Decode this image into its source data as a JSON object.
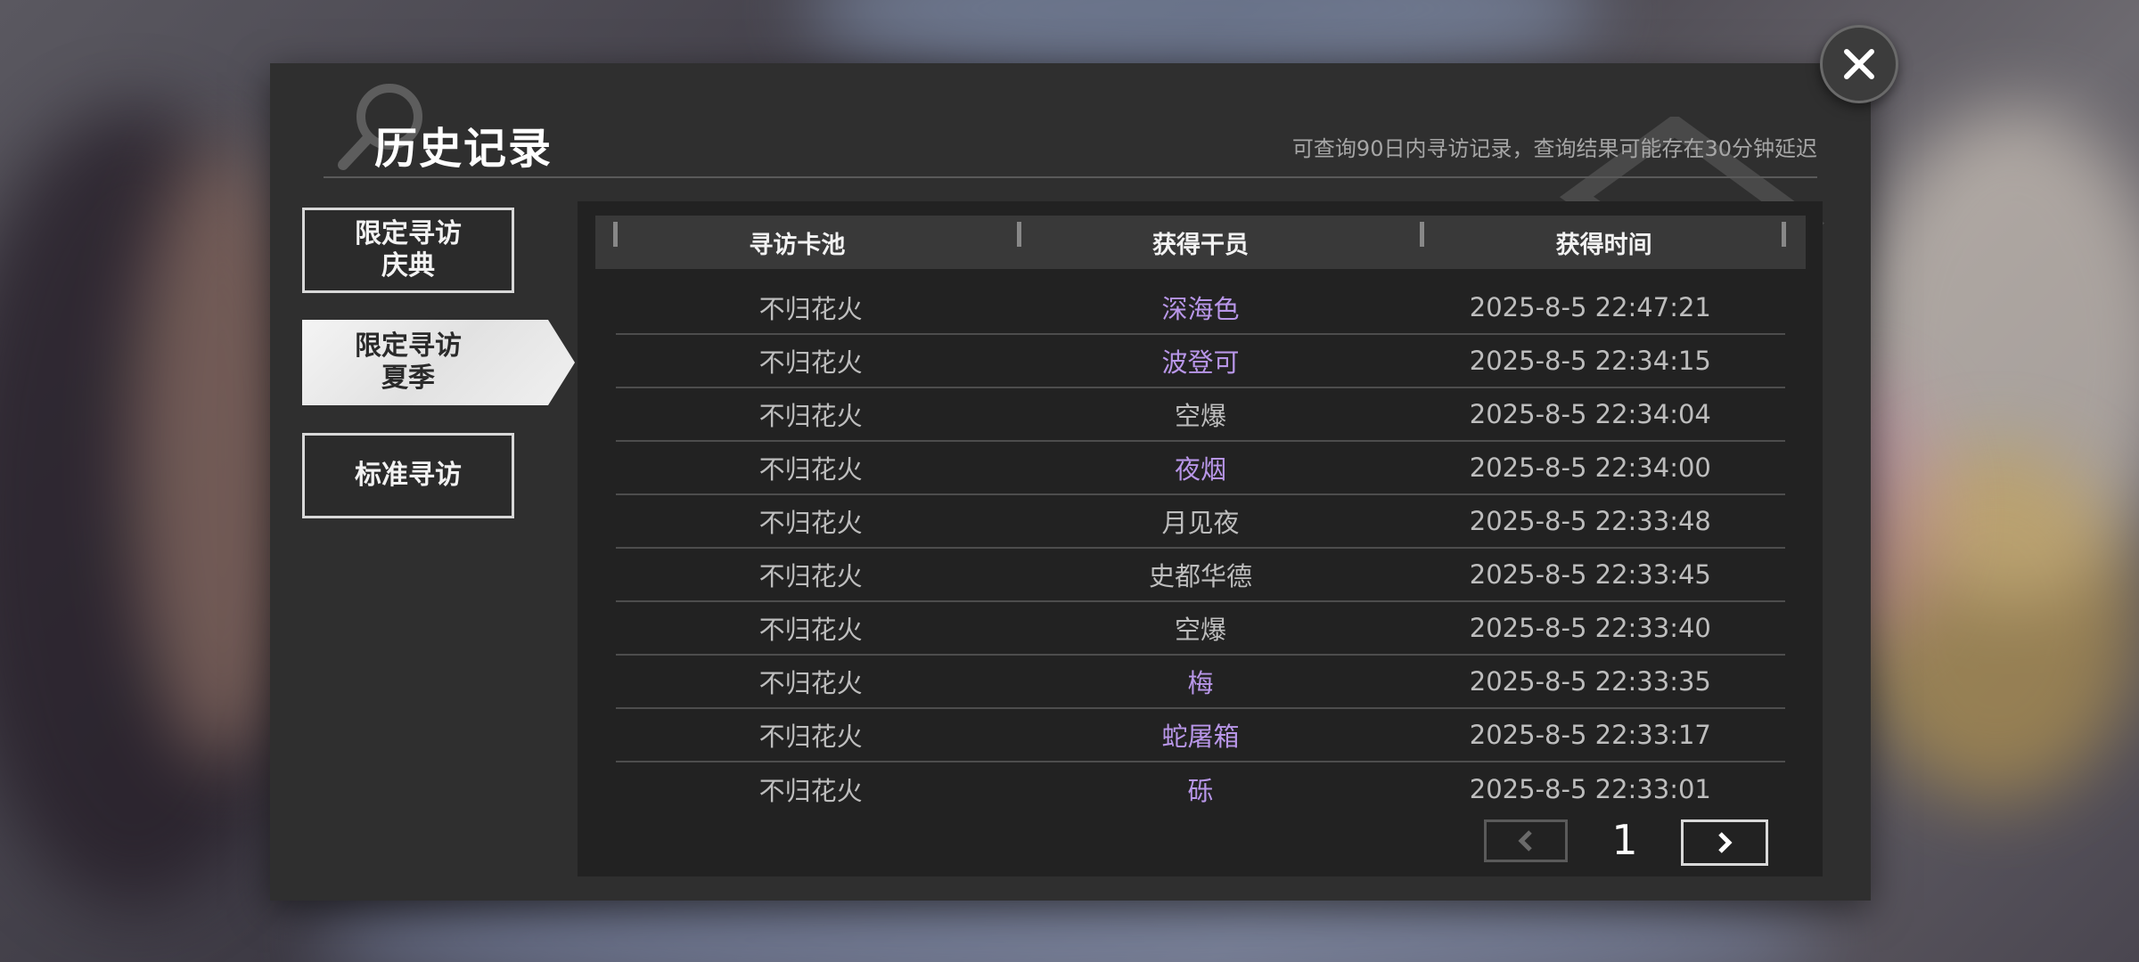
{
  "header": {
    "title": "历史记录",
    "subtitle": "可查询90日内寻访记录，查询结果可能存在30分钟延迟"
  },
  "tabs": [
    {
      "label": "限定寻访\n庆典",
      "active": false
    },
    {
      "label": "限定寻访\n夏季",
      "active": true
    },
    {
      "label": "标准寻访",
      "active": false
    }
  ],
  "table": {
    "columns": [
      "寻访卡池",
      "获得干员",
      "获得时间"
    ],
    "rows": [
      {
        "pool": "不归花火",
        "operator": "深海色",
        "time": "2025-8-5 22:47:21",
        "highlight": true
      },
      {
        "pool": "不归花火",
        "operator": "波登可",
        "time": "2025-8-5 22:34:15",
        "highlight": true
      },
      {
        "pool": "不归花火",
        "operator": "空爆",
        "time": "2025-8-5 22:34:04",
        "highlight": false
      },
      {
        "pool": "不归花火",
        "operator": "夜烟",
        "time": "2025-8-5 22:34:00",
        "highlight": true
      },
      {
        "pool": "不归花火",
        "operator": "月见夜",
        "time": "2025-8-5 22:33:48",
        "highlight": false
      },
      {
        "pool": "不归花火",
        "operator": "史都华德",
        "time": "2025-8-5 22:33:45",
        "highlight": false
      },
      {
        "pool": "不归花火",
        "operator": "空爆",
        "time": "2025-8-5 22:33:40",
        "highlight": false
      },
      {
        "pool": "不归花火",
        "operator": "梅",
        "time": "2025-8-5 22:33:35",
        "highlight": true
      },
      {
        "pool": "不归花火",
        "operator": "蛇屠箱",
        "time": "2025-8-5 22:33:17",
        "highlight": true
      },
      {
        "pool": "不归花火",
        "operator": "砾",
        "time": "2025-8-5 22:33:01",
        "highlight": true
      }
    ]
  },
  "pagination": {
    "current_page": "1"
  },
  "icons": {
    "close": "close-icon",
    "prev": "chevron-left-icon",
    "next": "chevron-right-icon"
  },
  "colors": {
    "highlight_operator": "#b896e8",
    "normal_text": "#bdbdbd",
    "panel_bg": "#2f2f2f"
  }
}
